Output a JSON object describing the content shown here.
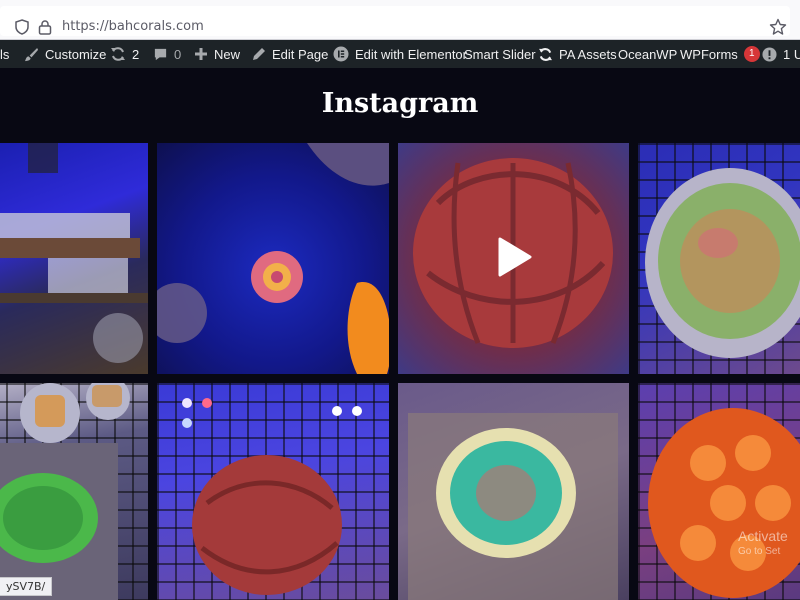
{
  "browser": {
    "url": "https://bahcorals.com"
  },
  "adminbar": {
    "partial_left": "ls",
    "customize": "Customize",
    "updates_count": "2",
    "comments_count": "0",
    "new": "New",
    "edit_page": "Edit Page",
    "edit_elementor": "Edit with Elementor",
    "smart_slider": "Smart Slider",
    "pa_assets": "PA Assets",
    "oceanwp": "OceanWP",
    "wpforms": "WPForms",
    "wpforms_badge": "1",
    "partial_right": "1 U"
  },
  "section": {
    "heading": "Instagram"
  },
  "watermark": {
    "line1": "Activate",
    "line2": "Go to Set"
  },
  "status": {
    "text": "ySV7B/"
  }
}
